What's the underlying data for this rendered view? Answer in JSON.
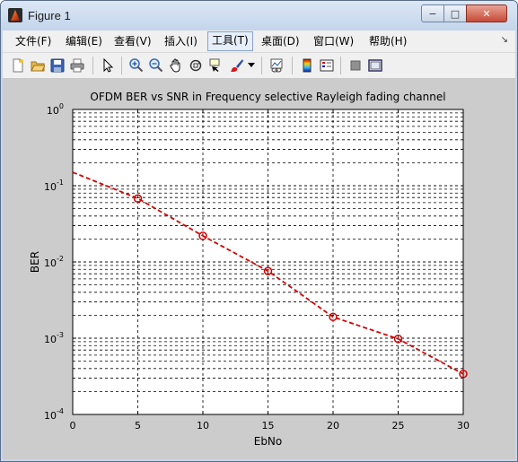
{
  "window": {
    "title": "Figure 1",
    "minimize_label": "−",
    "maximize_label": "□",
    "close_label": "✕"
  },
  "menu": {
    "items": [
      {
        "label": "文件(F)"
      },
      {
        "label": "编辑(E)"
      },
      {
        "label": "查看(V)"
      },
      {
        "label": "插入(I)"
      },
      {
        "label": "工具(T)"
      },
      {
        "label": "桌面(D)"
      },
      {
        "label": "窗口(W)"
      },
      {
        "label": "帮助(H)"
      }
    ],
    "active_index": 4,
    "overflow_arrow": "↘"
  },
  "toolbar": {
    "icons": [
      "new-figure-icon",
      "open-file-icon",
      "save-icon",
      "print-icon",
      "pointer-icon",
      "zoom-in-icon",
      "zoom-out-icon",
      "pan-icon",
      "rotate-3d-icon",
      "data-cursor-icon",
      "brush-icon",
      "brush-dropdown-icon",
      "link-plot-icon",
      "colorbar-icon",
      "legend-icon",
      "hide-plot-tools-icon",
      "show-plot-tools-icon"
    ]
  },
  "chart_data": {
    "type": "line",
    "title": "OFDM BER vs SNR in Frequency selective Rayleigh fading channel",
    "xlabel": "EbNo",
    "ylabel": "BER",
    "xlim": [
      0,
      30
    ],
    "ylim_log10": [
      -4,
      0
    ],
    "yscale": "log",
    "grid": true,
    "xticks": [
      "0",
      "5",
      "10",
      "15",
      "20",
      "25",
      "30"
    ],
    "yticks": [
      {
        "base": "10",
        "exp": "-4"
      },
      {
        "base": "10",
        "exp": "-3"
      },
      {
        "base": "10",
        "exp": "-2"
      },
      {
        "base": "10",
        "exp": "-1"
      },
      {
        "base": "10",
        "exp": "0"
      }
    ],
    "series": [
      {
        "color": "#d40000",
        "line_style": "dashed",
        "marker": "circle",
        "x": [
          0,
          5,
          10,
          15,
          20,
          25,
          30
        ],
        "y": [
          0.15,
          0.068,
          0.022,
          0.0076,
          0.0019,
          0.00098,
          0.00034
        ],
        "marker_x": [
          5,
          10,
          15,
          20,
          25,
          30
        ]
      }
    ]
  }
}
